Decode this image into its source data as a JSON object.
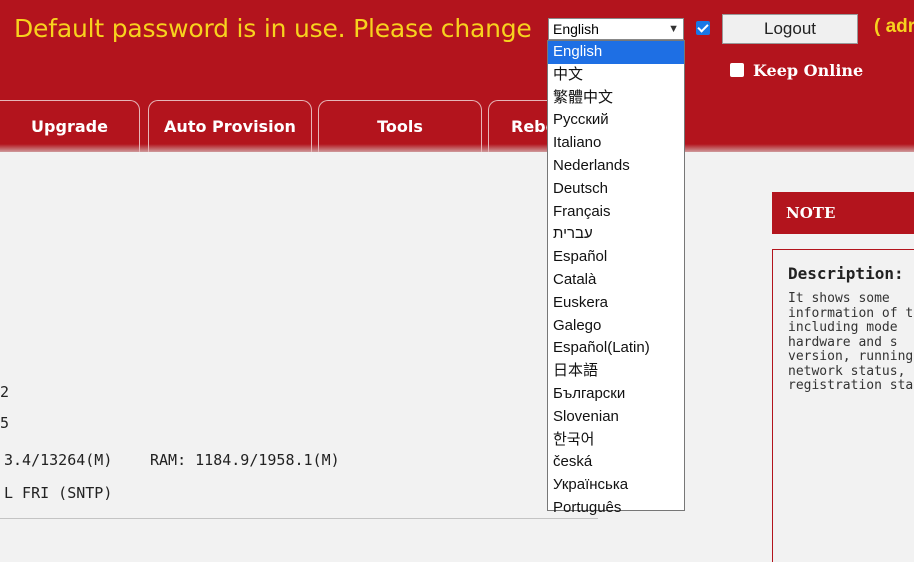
{
  "header": {
    "warning": "Default password is in use. Please change",
    "logout_label": "Logout",
    "admin_label": "( adr",
    "keep_online_label": "Keep Online"
  },
  "language_select": {
    "current": "English",
    "options": [
      "English",
      "中文",
      "繁體中文",
      "Русский",
      "Italiano",
      "Nederlands",
      "Deutsch",
      "Français",
      "עברית",
      "Español",
      "Català",
      "Euskera",
      "Galego",
      "Español(Latin)",
      "日本語",
      "Български",
      "Slovenian",
      "한국어",
      "česká",
      "Українська",
      "Português"
    ]
  },
  "nav": {
    "tabs": [
      "Upgrade",
      "Auto Provision",
      "Tools",
      "Rebo"
    ]
  },
  "info": {
    "line1": "2",
    "line2": "5",
    "storage": "3.4/13264(M)",
    "ram": "RAM: 1184.9/1958.1(M)",
    "time": "L FRI (SNTP)"
  },
  "note": {
    "header": "NOTE",
    "title": "Description:",
    "lines": [
      "It shows some",
      "information of t",
      "including mode",
      "hardware and s",
      "version, running",
      "network status,",
      "registration sta"
    ]
  },
  "colors": {
    "brand_red": "#b3141d",
    "warning_yellow": "#f7d21e",
    "selection_blue": "#1e6fe4"
  }
}
